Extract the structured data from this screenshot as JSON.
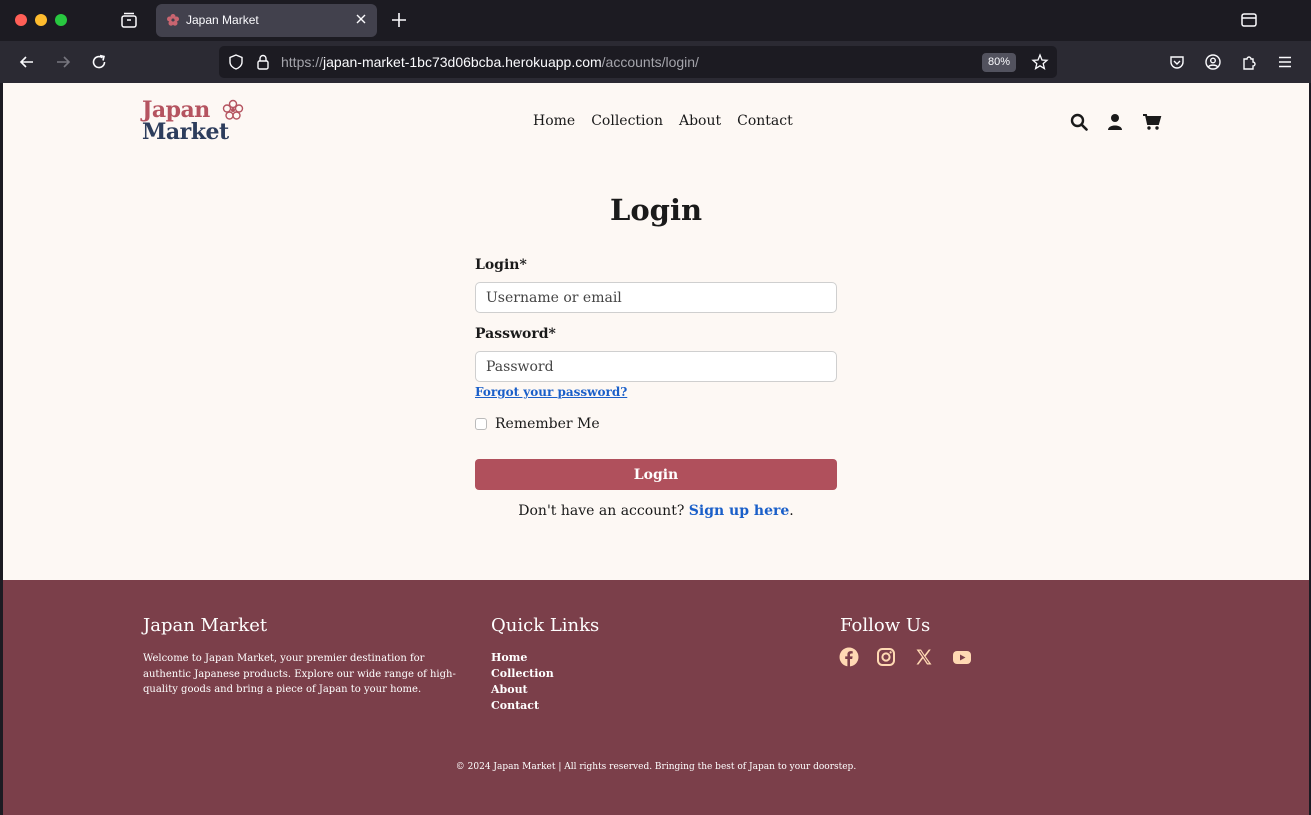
{
  "browser": {
    "tab_title": "Japan Market",
    "url_scheme": "https://",
    "url_host": "japan-market-1bc73d06bcba.herokuapp.com",
    "url_path": "/accounts/login/",
    "zoom": "80%"
  },
  "header": {
    "logo_line1": "Japan",
    "logo_line2": "Market",
    "nav": [
      "Home",
      "Collection",
      "About",
      "Contact"
    ]
  },
  "login": {
    "title": "Login",
    "login_label": "Login*",
    "login_placeholder": "Username or email",
    "password_label": "Password*",
    "password_placeholder": "Password",
    "forgot": "Forgot your password?",
    "remember": "Remember Me",
    "submit": "Login",
    "no_account": "Don't have an account?",
    "signup_link": "Sign up here",
    "signup_end": "."
  },
  "footer": {
    "about_title": "Japan Market",
    "about_text": "Welcome to Japan Market, your premier destination for authentic Japanese products. Explore our wide range of high-quality goods and bring a piece of Japan to your home.",
    "links_title": "Quick Links",
    "links": [
      "Home",
      "Collection",
      "About",
      "Contact"
    ],
    "follow_title": "Follow Us",
    "social": [
      "facebook-icon",
      "instagram-icon",
      "x-icon",
      "youtube-icon"
    ],
    "copyright": "© 2024 Japan Market | All rights reserved. Bringing the best of Japan to your doorstep."
  },
  "colors": {
    "accent": "#b0505c",
    "footer": "#7b3f4a",
    "page_bg": "#fdf8f4",
    "link": "#1a5fc9",
    "social_icon": "#ffd9b3"
  }
}
